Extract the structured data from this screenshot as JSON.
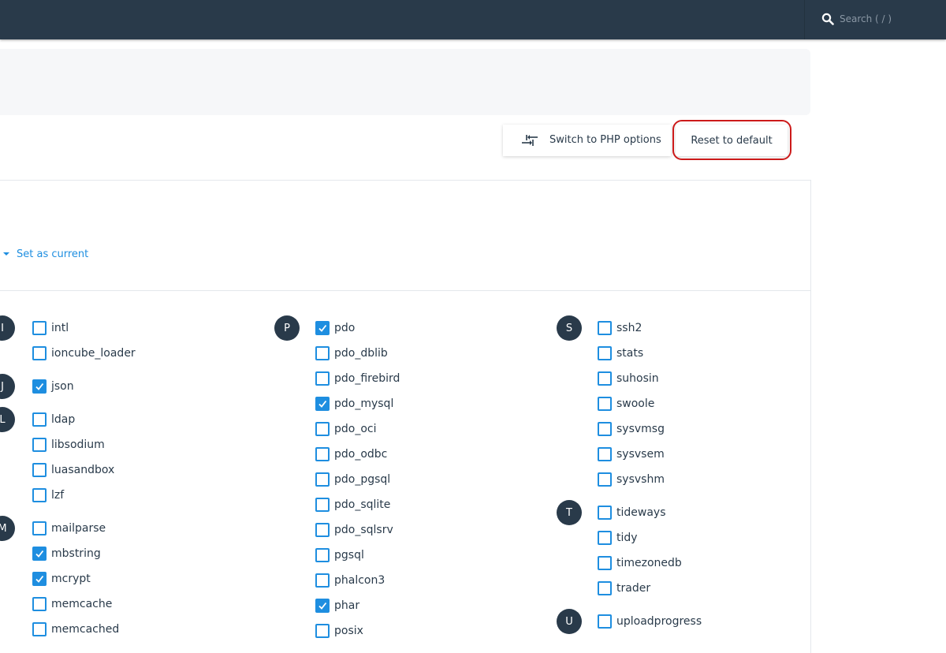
{
  "search": {
    "placeholder": "Search ( / )"
  },
  "toolbar": {
    "switch_label": "Switch to PHP options",
    "reset_label": "Reset to default"
  },
  "version": {
    "set_current_label": "Set as current"
  },
  "columns": [
    {
      "groups": [
        {
          "letter": "I",
          "items": [
            {
              "name": "intl",
              "checked": false
            },
            {
              "name": "ioncube_loader",
              "checked": false
            }
          ]
        },
        {
          "letter": "J",
          "items": [
            {
              "name": "json",
              "checked": true
            }
          ]
        },
        {
          "letter": "L",
          "items": [
            {
              "name": "ldap",
              "checked": false
            },
            {
              "name": "libsodium",
              "checked": false
            },
            {
              "name": "luasandbox",
              "checked": false
            },
            {
              "name": "lzf",
              "checked": false
            }
          ]
        },
        {
          "letter": "M",
          "items": [
            {
              "name": "mailparse",
              "checked": false
            },
            {
              "name": "mbstring",
              "checked": true
            },
            {
              "name": "mcrypt",
              "checked": true
            },
            {
              "name": "memcache",
              "checked": false
            },
            {
              "name": "memcached",
              "checked": false
            }
          ]
        }
      ]
    },
    {
      "groups": [
        {
          "letter": "P",
          "items": [
            {
              "name": "pdo",
              "checked": true
            },
            {
              "name": "pdo_dblib",
              "checked": false
            },
            {
              "name": "pdo_firebird",
              "checked": false
            },
            {
              "name": "pdo_mysql",
              "checked": true
            },
            {
              "name": "pdo_oci",
              "checked": false
            },
            {
              "name": "pdo_odbc",
              "checked": false
            },
            {
              "name": "pdo_pgsql",
              "checked": false
            },
            {
              "name": "pdo_sqlite",
              "checked": false
            },
            {
              "name": "pdo_sqlsrv",
              "checked": false
            },
            {
              "name": "pgsql",
              "checked": false
            },
            {
              "name": "phalcon3",
              "checked": false
            },
            {
              "name": "phar",
              "checked": true
            },
            {
              "name": "posix",
              "checked": false
            }
          ]
        }
      ]
    },
    {
      "groups": [
        {
          "letter": "S",
          "items": [
            {
              "name": "ssh2",
              "checked": false
            },
            {
              "name": "stats",
              "checked": false
            },
            {
              "name": "suhosin",
              "checked": false
            },
            {
              "name": "swoole",
              "checked": false
            },
            {
              "name": "sysvmsg",
              "checked": false
            },
            {
              "name": "sysvsem",
              "checked": false
            },
            {
              "name": "sysvshm",
              "checked": false
            }
          ]
        },
        {
          "letter": "T",
          "items": [
            {
              "name": "tideways",
              "checked": false
            },
            {
              "name": "tidy",
              "checked": false
            },
            {
              "name": "timezonedb",
              "checked": false
            },
            {
              "name": "trader",
              "checked": false
            }
          ]
        },
        {
          "letter": "U",
          "items": [
            {
              "name": "uploadprogress",
              "checked": false
            }
          ]
        }
      ]
    }
  ],
  "colors": {
    "accent": "#1e8ee0",
    "navy": "#293a4a",
    "highlight": "#cc1a1a"
  }
}
